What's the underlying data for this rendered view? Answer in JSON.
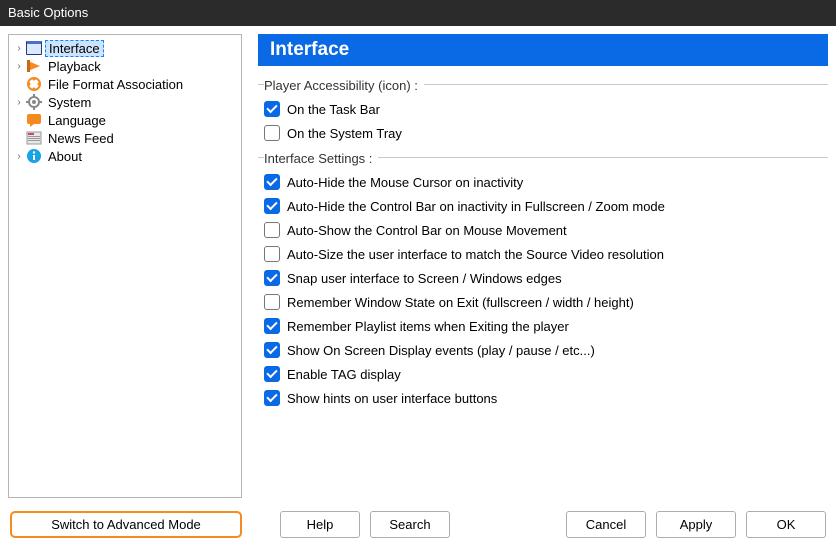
{
  "window": {
    "title": "Basic Options"
  },
  "sidebar": {
    "items": [
      {
        "label": "Interface",
        "icon": "interface-icon",
        "expandable": true,
        "selected": true
      },
      {
        "label": "Playback",
        "icon": "playback-icon",
        "expandable": true,
        "selected": false
      },
      {
        "label": "File Format Association",
        "icon": "file-format-icon",
        "expandable": false,
        "selected": false
      },
      {
        "label": "System",
        "icon": "system-icon",
        "expandable": true,
        "selected": false
      },
      {
        "label": "Language",
        "icon": "language-icon",
        "expandable": false,
        "selected": false
      },
      {
        "label": "News Feed",
        "icon": "news-feed-icon",
        "expandable": false,
        "selected": false
      },
      {
        "label": "About",
        "icon": "about-icon",
        "expandable": true,
        "selected": false
      }
    ]
  },
  "main": {
    "heading": "Interface",
    "groups": [
      {
        "title": "Player Accessibility (icon) :",
        "options": [
          {
            "label": "On the Task Bar",
            "checked": true
          },
          {
            "label": "On the System Tray",
            "checked": false
          }
        ]
      },
      {
        "title": "Interface Settings :",
        "options": [
          {
            "label": "Auto-Hide the Mouse Cursor on inactivity",
            "checked": true
          },
          {
            "label": "Auto-Hide the Control Bar on inactivity in Fullscreen / Zoom mode",
            "checked": true
          },
          {
            "label": "Auto-Show the Control Bar on Mouse Movement",
            "checked": false
          },
          {
            "label": "Auto-Size the user interface to match the Source Video resolution",
            "checked": false
          },
          {
            "label": "Snap user interface to Screen / Windows edges",
            "checked": true
          },
          {
            "label": "Remember Window State on Exit (fullscreen / width / height)",
            "checked": false
          },
          {
            "label": "Remember Playlist items when Exiting the player",
            "checked": true
          },
          {
            "label": "Show On Screen Display events (play / pause / etc...)",
            "checked": true
          },
          {
            "label": "Enable TAG display",
            "checked": true
          },
          {
            "label": "Show hints on user interface buttons",
            "checked": true
          }
        ]
      }
    ]
  },
  "buttons": {
    "advanced": "Switch to Advanced Mode",
    "help": "Help",
    "search": "Search",
    "cancel": "Cancel",
    "apply": "Apply",
    "ok": "OK"
  }
}
